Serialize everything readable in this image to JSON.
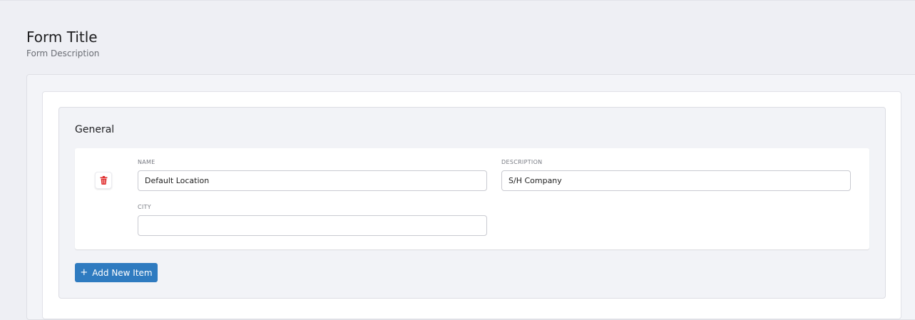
{
  "form": {
    "title": "Form Title",
    "description": "Form Description"
  },
  "section": {
    "title": "General",
    "item": {
      "delete_icon": "trash-icon",
      "fields": {
        "name": {
          "label": "NAME",
          "value": "Default Location"
        },
        "description": {
          "label": "DESCRIPTION",
          "value": "S/H Company"
        },
        "city": {
          "label": "CITY",
          "value": ""
        }
      }
    },
    "add_button": {
      "icon": "plus-icon",
      "label": "Add New Item"
    }
  },
  "colors": {
    "accent": "#2f7bc0",
    "delete": "#e03131",
    "background": "#eeeff4"
  }
}
